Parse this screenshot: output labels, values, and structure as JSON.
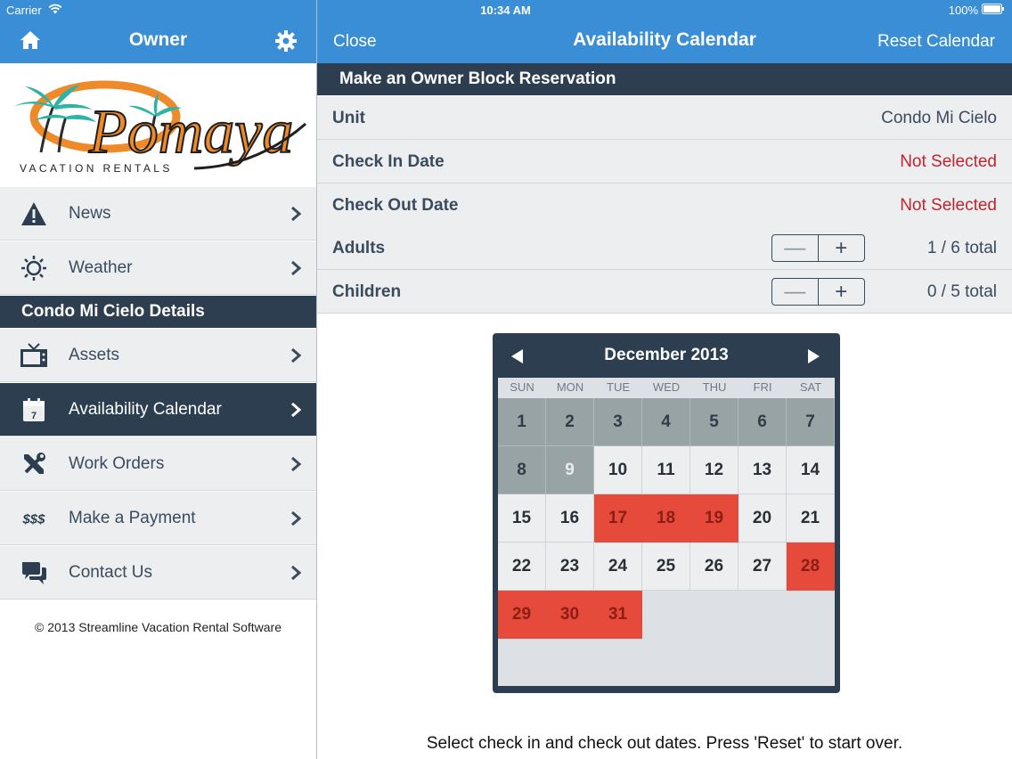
{
  "status": {
    "carrier": "Carrier",
    "time": "10:34 AM",
    "battery": "100%"
  },
  "sidebar": {
    "title": "Owner",
    "logo_text": "Pomaya",
    "logo_subtitle": "VACATION RENTALS",
    "items_top": [
      {
        "label": "News",
        "icon": "warning-icon"
      },
      {
        "label": "Weather",
        "icon": "sun-icon"
      }
    ],
    "section_title": "Condo Mi Cielo Details",
    "items_bottom": [
      {
        "label": "Assets",
        "icon": "tv-icon"
      },
      {
        "label": "Availability Calendar",
        "icon": "calendar-icon"
      },
      {
        "label": "Work Orders",
        "icon": "tools-icon"
      },
      {
        "label": "Make a Payment",
        "icon": "dollar-icon"
      },
      {
        "label": "Contact Us",
        "icon": "chat-icon"
      }
    ],
    "copyright": "© 2013 Streamline Vacation Rental Software"
  },
  "main": {
    "close_label": "Close",
    "title": "Availability Calendar",
    "reset_label": "Reset Calendar",
    "block_header": "Make an Owner Block Reservation",
    "rows": {
      "unit": {
        "label": "Unit",
        "value": "Condo Mi Cielo"
      },
      "checkin": {
        "label": "Check In Date",
        "value": "Not Selected"
      },
      "checkout": {
        "label": "Check Out Date",
        "value": "Not Selected"
      },
      "adults": {
        "label": "Adults",
        "value": "1 / 6 total"
      },
      "children": {
        "label": "Children",
        "value": "0 / 5 total"
      }
    },
    "stepper": {
      "minus": "—",
      "plus": "+"
    },
    "calendar": {
      "month_label": "December 2013",
      "weekdays": [
        "SUN",
        "MON",
        "TUE",
        "WED",
        "THU",
        "FRI",
        "SAT"
      ],
      "days": [
        {
          "n": "1",
          "state": "past"
        },
        {
          "n": "2",
          "state": "past"
        },
        {
          "n": "3",
          "state": "past"
        },
        {
          "n": "4",
          "state": "past"
        },
        {
          "n": "5",
          "state": "past"
        },
        {
          "n": "6",
          "state": "past"
        },
        {
          "n": "7",
          "state": "past"
        },
        {
          "n": "8",
          "state": "past"
        },
        {
          "n": "9",
          "state": "past-light"
        },
        {
          "n": "10",
          "state": "avail"
        },
        {
          "n": "11",
          "state": "avail"
        },
        {
          "n": "12",
          "state": "avail"
        },
        {
          "n": "13",
          "state": "avail"
        },
        {
          "n": "14",
          "state": "avail"
        },
        {
          "n": "15",
          "state": "avail"
        },
        {
          "n": "16",
          "state": "avail"
        },
        {
          "n": "17",
          "state": "booked"
        },
        {
          "n": "18",
          "state": "booked"
        },
        {
          "n": "19",
          "state": "booked"
        },
        {
          "n": "20",
          "state": "avail"
        },
        {
          "n": "21",
          "state": "avail"
        },
        {
          "n": "22",
          "state": "avail"
        },
        {
          "n": "23",
          "state": "avail"
        },
        {
          "n": "24",
          "state": "avail"
        },
        {
          "n": "25",
          "state": "avail"
        },
        {
          "n": "26",
          "state": "avail"
        },
        {
          "n": "27",
          "state": "avail"
        },
        {
          "n": "28",
          "state": "booked"
        },
        {
          "n": "29",
          "state": "booked"
        },
        {
          "n": "30",
          "state": "booked"
        },
        {
          "n": "31",
          "state": "booked"
        }
      ]
    },
    "instructions": "Select check in and check out dates. Press 'Reset' to start over."
  },
  "colors": {
    "bar_blue": "#3a8ed6",
    "navy": "#2c3e50",
    "booked_red": "#e64a3b",
    "past_gray": "#98a3a6",
    "alert_red": "#c0242c"
  }
}
